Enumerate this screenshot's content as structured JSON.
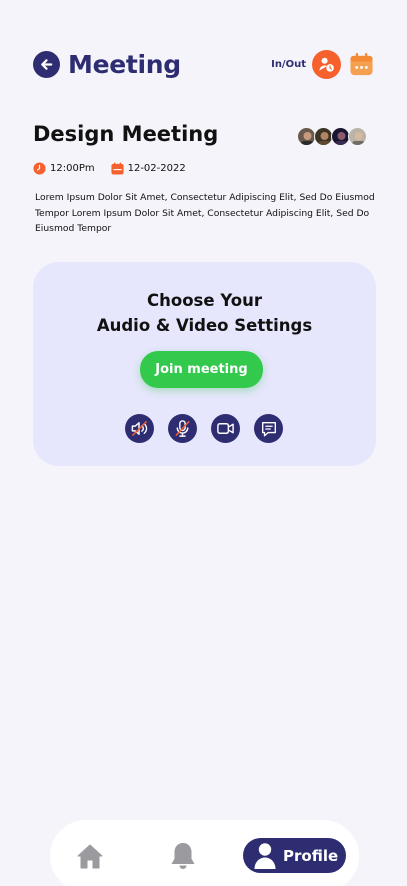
{
  "header": {
    "title": "Meeting",
    "inout_label": "In/Out",
    "accent_color": "#2e2d72",
    "inout_color": "#f5602d",
    "calendar_color": "#f5a051"
  },
  "meeting": {
    "title": "Design Meeting",
    "time": "12:00Pm",
    "date": "12-02-2022",
    "description": "Lorem Ipsum Dolor Sit Amet, Consectetur Adipiscing Elit, Sed Do Eiusmod Tempor Lorem Ipsum Dolor Sit Amet, Consectetur Adipiscing Elit, Sed Do Eiusmod Tempor"
  },
  "settings": {
    "title_line1": "Choose Your",
    "title_line2": "Audio & Video Settings",
    "join_label": "Join meeting",
    "join_color": "#33c94d",
    "card_color": "#e6e6fc",
    "controls": [
      "speaker-muted-icon",
      "microphone-muted-icon",
      "video-camera-icon",
      "chat-icon"
    ]
  },
  "nav": {
    "items": [
      "home-icon",
      "bell-icon",
      "profile-icon"
    ],
    "profile_label": "Profile"
  }
}
